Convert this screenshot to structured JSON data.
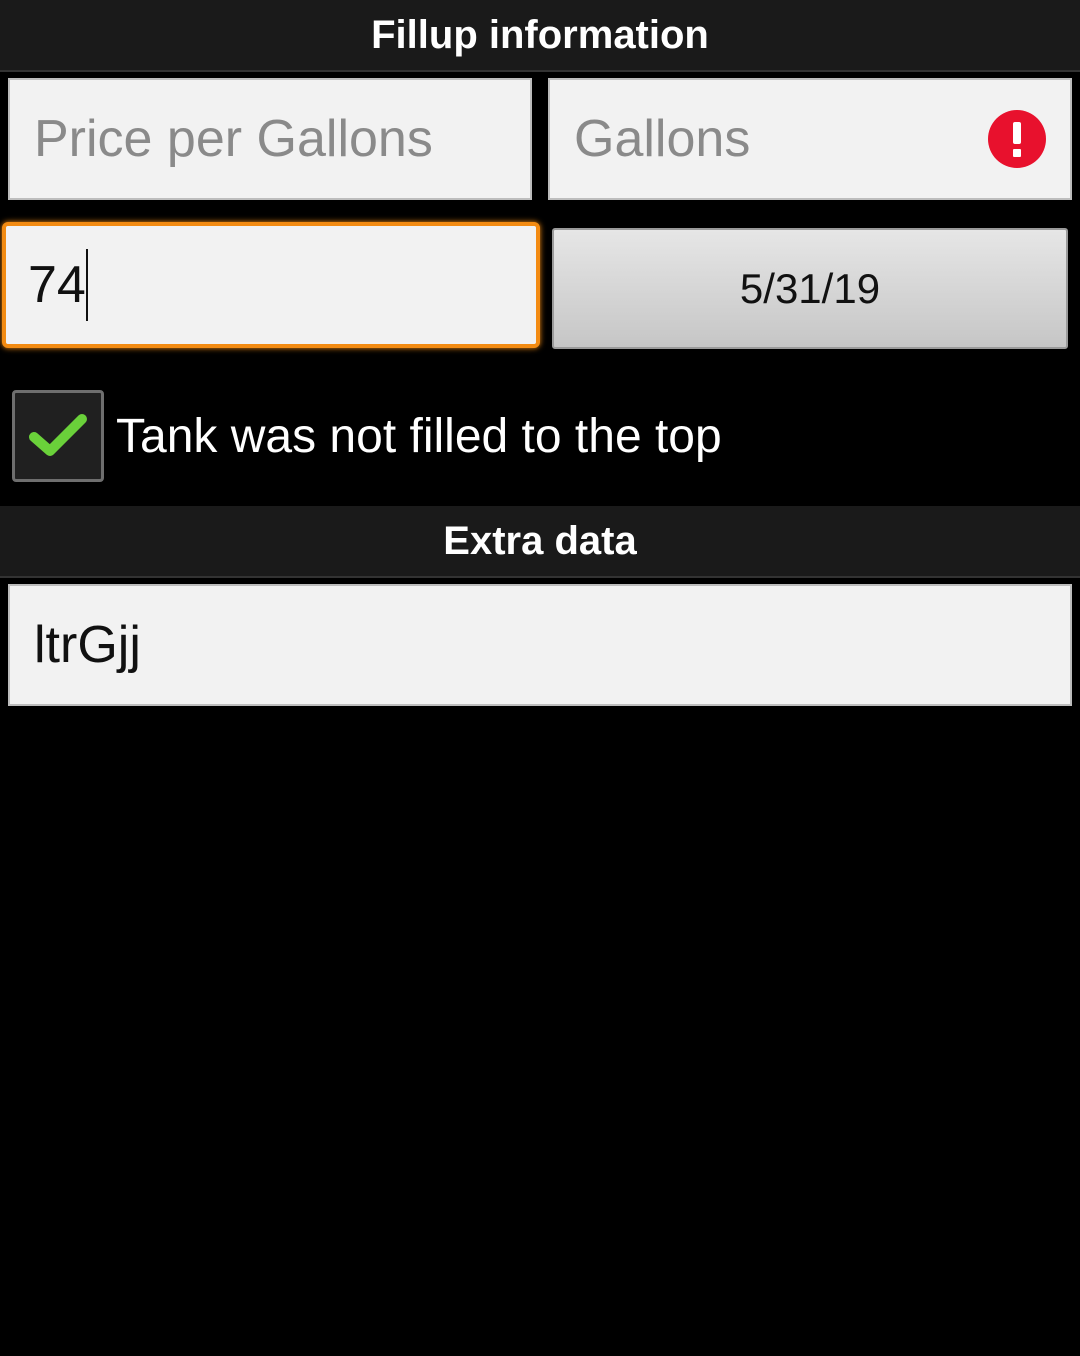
{
  "sections": {
    "fillup_header": "Fillup information",
    "extra_header": "Extra data"
  },
  "fields": {
    "price_per_gallon": {
      "placeholder": "Price per Gallons",
      "value": ""
    },
    "gallons": {
      "placeholder": "Gallons",
      "value": "",
      "error": true
    },
    "odometer": {
      "value": "74",
      "focused": true
    },
    "date_button": "5/31/19",
    "extra_data": {
      "value": "ltrGjj"
    }
  },
  "checkbox": {
    "label": "Tank was not filled to the top",
    "checked": true
  },
  "colors": {
    "focus_accent": "#f38b12",
    "error": "#e8112d",
    "check": "#6ad13a"
  },
  "icons": {
    "error": "error-icon",
    "check": "checkmark-icon"
  }
}
